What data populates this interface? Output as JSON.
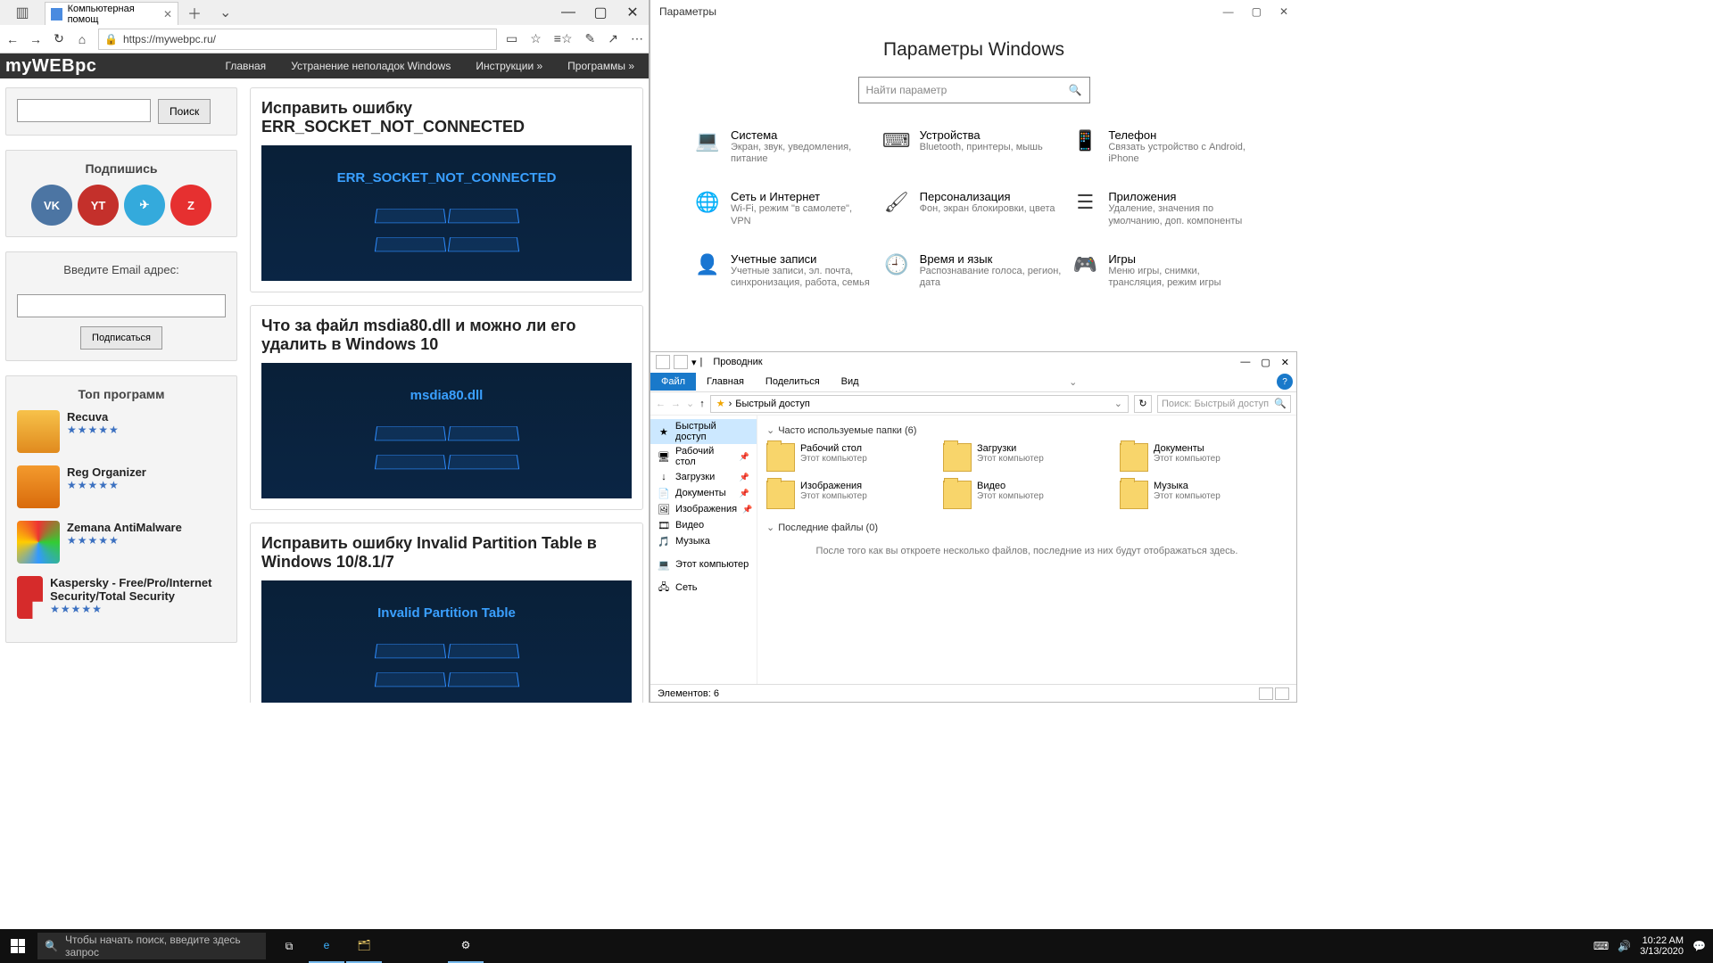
{
  "edge": {
    "tab_title": "Компьютерная помощ",
    "url": "https://mywebpc.ru/",
    "nav": {
      "back": "←",
      "fwd": "→",
      "refresh": "↻",
      "home": "⌂"
    },
    "addr_icons": {
      "read": "▭",
      "star": "☆",
      "favs": "≡☆",
      "edit": "✎",
      "share": "↗",
      "more": "⋯"
    }
  },
  "site": {
    "brand": "myWEBpc",
    "menu": [
      "Главная",
      "Устранение неполадок Windows",
      "Инструкции »",
      "Программы »"
    ],
    "search_button": "Поиск",
    "subscribe_title": "Подпишись",
    "email_label": "Введите Email адрес:",
    "email_button": "Подписаться",
    "top_programs_title": "Топ программ",
    "top_programs": [
      {
        "name": "Recuva"
      },
      {
        "name": "Reg Organizer"
      },
      {
        "name": "Zemana AntiMalware"
      },
      {
        "name": "Kaspersky - Free/Pro/Internet Security/Total Security"
      }
    ],
    "stars": "★★★★★",
    "articles": [
      {
        "title": "Исправить ошибку ERR_SOCKET_NOT_CONNECTED",
        "thumb": "ERR_SOCKET_NOT_CONNECTED"
      },
      {
        "title": "Что за файл msdia80.dll и можно ли его удалить в Windows 10",
        "thumb": "msdia80.dll"
      },
      {
        "title": "Исправить ошибку Invalid Partition Table в Windows 10/8.1/7",
        "thumb": "Invalid Partition Table"
      }
    ]
  },
  "settings": {
    "window_title": "Параметры",
    "heading": "Параметры Windows",
    "search_placeholder": "Найти параметр",
    "items": [
      {
        "icon": "💻",
        "title": "Система",
        "sub": "Экран, звук, уведомления, питание"
      },
      {
        "icon": "⌨",
        "title": "Устройства",
        "sub": "Bluetooth, принтеры, мышь"
      },
      {
        "icon": "📱",
        "title": "Телефон",
        "sub": "Связать устройство с Android, iPhone"
      },
      {
        "icon": "🌐",
        "title": "Сеть и Интернет",
        "sub": "Wi-Fi, режим \"в самолете\", VPN"
      },
      {
        "icon": "🖌",
        "title": "Персонализация",
        "sub": "Фон, экран блокировки, цвета"
      },
      {
        "icon": "☰",
        "title": "Приложения",
        "sub": "Удаление, значения по умолчанию, доп. компоненты"
      },
      {
        "icon": "👤",
        "title": "Учетные записи",
        "sub": "Учетные записи, эл. почта, синхронизация, работа, семья"
      },
      {
        "icon": "🕘",
        "title": "Время и язык",
        "sub": "Распознавание голоса, регион, дата"
      },
      {
        "icon": "🎮",
        "title": "Игры",
        "sub": "Меню игры, снимки, трансляция, режим игры"
      }
    ]
  },
  "explorer": {
    "window_title": "Проводник",
    "ribbon": {
      "file": "Файл",
      "home": "Главная",
      "share": "Поделиться",
      "view": "Вид"
    },
    "breadcrumb": "Быстрый доступ",
    "search_placeholder": "Поиск: Быстрый доступ",
    "nav": [
      {
        "label": "Быстрый доступ",
        "icon": "★",
        "active": true
      },
      {
        "label": "Рабочий стол",
        "icon": "🖥",
        "pinned": true
      },
      {
        "label": "Загрузки",
        "icon": "↓",
        "pinned": true
      },
      {
        "label": "Документы",
        "icon": "📄",
        "pinned": true
      },
      {
        "label": "Изображения",
        "icon": "🖼",
        "pinned": true
      },
      {
        "label": "Видео",
        "icon": "🎞"
      },
      {
        "label": "Музыка",
        "icon": "🎵"
      }
    ],
    "nav_computer": "Этот компьютер",
    "nav_network": "Сеть",
    "group_folders": "Часто используемые папки (6)",
    "group_recent": "Последние файлы (0)",
    "folders": [
      {
        "name": "Рабочий стол",
        "sub": "Этот компьютер"
      },
      {
        "name": "Загрузки",
        "sub": "Этот компьютер"
      },
      {
        "name": "Документы",
        "sub": "Этот компьютер"
      },
      {
        "name": "Изображения",
        "sub": "Этот компьютер"
      },
      {
        "name": "Видео",
        "sub": "Этот компьютер"
      },
      {
        "name": "Музыка",
        "sub": "Этот компьютер"
      }
    ],
    "empty_msg": "После того как вы откроете несколько файлов, последние из них будут отображаться здесь.",
    "status": "Элементов: 6"
  },
  "taskbar": {
    "search_placeholder": "Чтобы начать поиск, введите здесь запрос",
    "time": "10:22 AM",
    "date": "3/13/2020"
  }
}
